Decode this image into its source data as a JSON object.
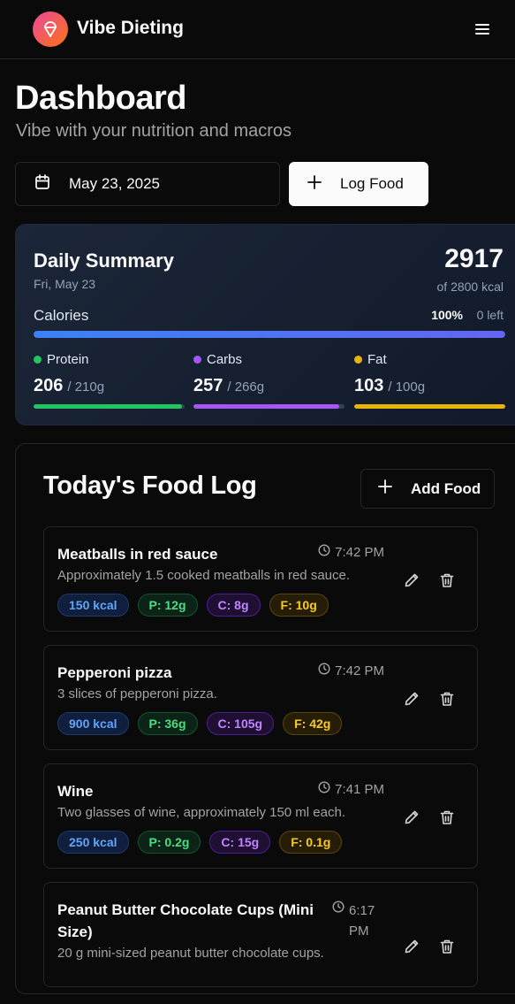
{
  "app": {
    "name": "Vibe Dieting"
  },
  "header": {
    "title": "Dashboard",
    "subtitle": "Vibe with your nutrition and macros"
  },
  "controls": {
    "date": "May 23, 2025",
    "log_food_label": "Log Food"
  },
  "summary": {
    "title": "Daily Summary",
    "date": "Fri, May 23",
    "total": "2917",
    "of_label": "of 2800 kcal",
    "calories_label": "Calories",
    "percent": "100%",
    "left": "0 left",
    "calories_progress": 1.0,
    "macros": [
      {
        "name": "Protein",
        "value": "206",
        "goal": "/ 210g",
        "color": "#22c55e",
        "progress": 0.981
      },
      {
        "name": "Carbs",
        "value": "257",
        "goal": "/ 266g",
        "color": "#a855f7",
        "progress": 0.966
      },
      {
        "name": "Fat",
        "value": "103",
        "goal": "/ 100g",
        "color": "#eab308",
        "progress": 1.0
      }
    ]
  },
  "food_log": {
    "title": "Today's Food Log",
    "add_label": "Add Food",
    "entries": [
      {
        "name": "Meatballs in red sauce",
        "time": "7:42 PM",
        "desc": "Approximately 1.5 cooked meatballs in red sauce.",
        "kcal": "150 kcal",
        "protein": "P: 12g",
        "carbs": "C: 8g",
        "fat": "F: 10g"
      },
      {
        "name": "Pepperoni pizza",
        "time": "7:42 PM",
        "desc": "3 slices of pepperoni pizza.",
        "kcal": "900 kcal",
        "protein": "P: 36g",
        "carbs": "C: 105g",
        "fat": "F: 42g"
      },
      {
        "name": "Wine",
        "time": "7:41 PM",
        "desc": "Two glasses of wine, approximately 150 ml each.",
        "kcal": "250 kcal",
        "protein": "P: 0.2g",
        "carbs": "C: 15g",
        "fat": "F: 0.1g"
      },
      {
        "name": "Peanut Butter Chocolate Cups (Mini Size)",
        "time": "6:17 PM",
        "desc": "20 g mini-sized peanut butter chocolate cups.",
        "kcal": "",
        "protein": "",
        "carbs": "",
        "fat": ""
      }
    ]
  },
  "icons": {
    "logo": "ice-cream-icon",
    "menu": "hamburger-menu-icon",
    "calendar": "calendar-icon",
    "plus": "plus-icon",
    "clock": "clock-icon",
    "edit": "pencil-icon",
    "delete": "trash-icon"
  }
}
